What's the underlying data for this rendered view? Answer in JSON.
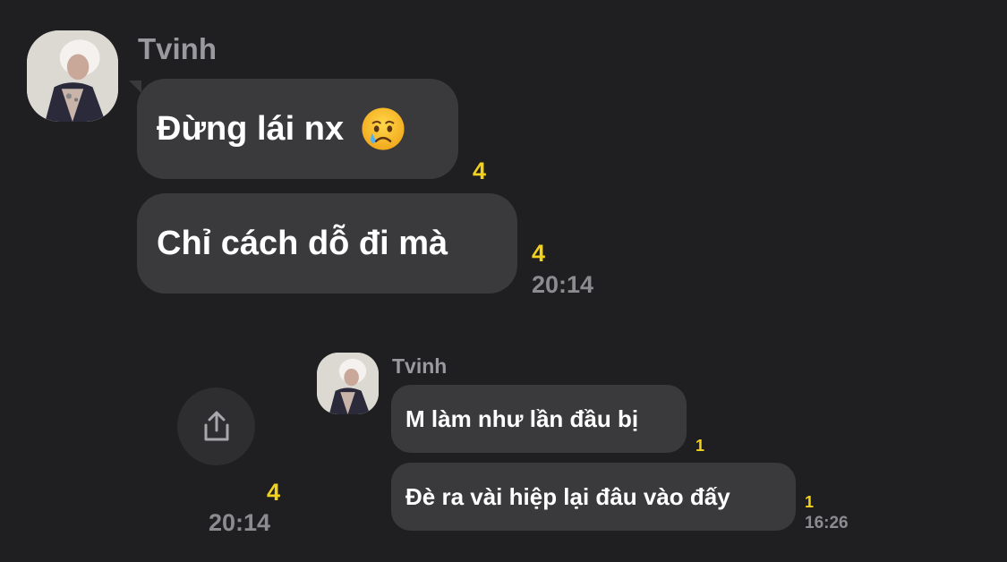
{
  "messages_main": {
    "sender_name": "Tvinh",
    "bubbles": [
      {
        "text": "Đừng lái nx",
        "emoji": "crying-face",
        "unread": "4"
      },
      {
        "text": "Chỉ cách dỗ đi mà",
        "unread": "4",
        "time": "20:14"
      }
    ]
  },
  "forwarded_preview": {
    "share_icon": "share-icon",
    "outer_unread": "4",
    "outer_time": "20:14",
    "sender_name": "Tvinh",
    "bubbles": [
      {
        "text": "M làm như lần đầu bị",
        "unread": "1"
      },
      {
        "text": "Đè ra vài hiệp lại đâu vào đấy",
        "unread": "1",
        "time": "16:26"
      }
    ]
  },
  "colors": {
    "background": "#1f1f21",
    "bubble": "#3a3a3d",
    "unread": "#f2d21c",
    "meta_text": "#8c8c90"
  }
}
